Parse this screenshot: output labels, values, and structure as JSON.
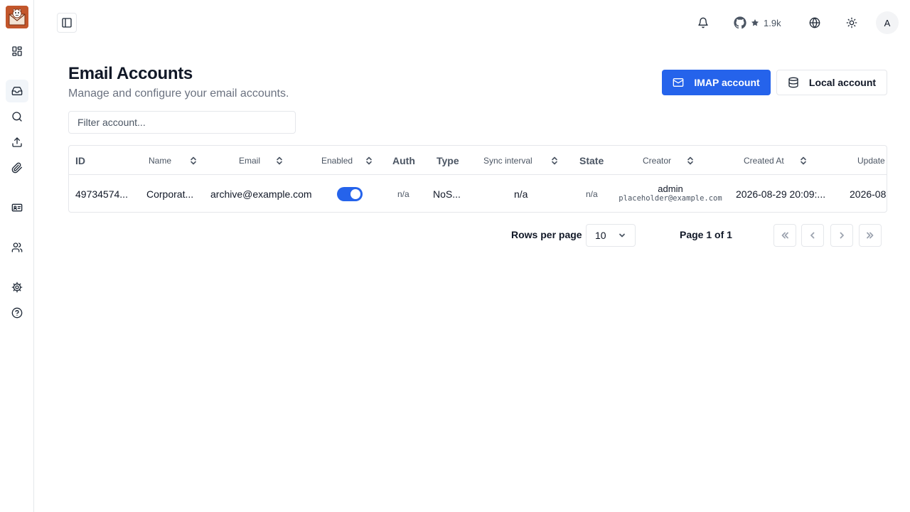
{
  "topbar": {
    "github_stars": "1.9k",
    "avatar_initial": "A"
  },
  "header": {
    "title": "Email Accounts",
    "subtitle": "Manage and configure your email accounts.",
    "imap_button": "IMAP account",
    "local_button": "Local account"
  },
  "filter": {
    "placeholder": "Filter account...",
    "value": ""
  },
  "table": {
    "columns": {
      "id": "ID",
      "name": "Name",
      "email": "Email",
      "enabled": "Enabled",
      "auth": "Auth",
      "type": "Type",
      "sync_interval": "Sync interval",
      "state": "State",
      "creator": "Creator",
      "created_at": "Created At",
      "updated_at": "Update"
    },
    "rows": [
      {
        "id": "49734574...",
        "name": "Corporat...",
        "email": "archive@example.com",
        "enabled": true,
        "auth": "n/a",
        "type": "NoS...",
        "sync_interval": "n/a",
        "state": "n/a",
        "creator_name": "admin",
        "creator_email": "placeholder@example.com",
        "created_at": "2026-08-29 20:09:...",
        "updated_at": "2026-08"
      }
    ]
  },
  "pagination": {
    "rows_per_page_label": "Rows per page",
    "rows_per_page_value": "10",
    "page_info": "Page 1 of 1"
  },
  "colors": {
    "primary": "#2563eb",
    "border": "#e5e7eb",
    "muted_text": "#6b7280",
    "logo": "#c2562b"
  },
  "icons": {
    "sidebar": [
      "dashboard-icon",
      "inbox-icon",
      "search-icon",
      "upload-icon",
      "paperclip-icon",
      "id-card-icon",
      "users-icon",
      "settings-icon",
      "help-icon"
    ],
    "topbar": [
      "sidebar-toggle-icon",
      "bell-icon",
      "github-icon",
      "star-icon",
      "globe-icon",
      "sun-icon"
    ]
  }
}
